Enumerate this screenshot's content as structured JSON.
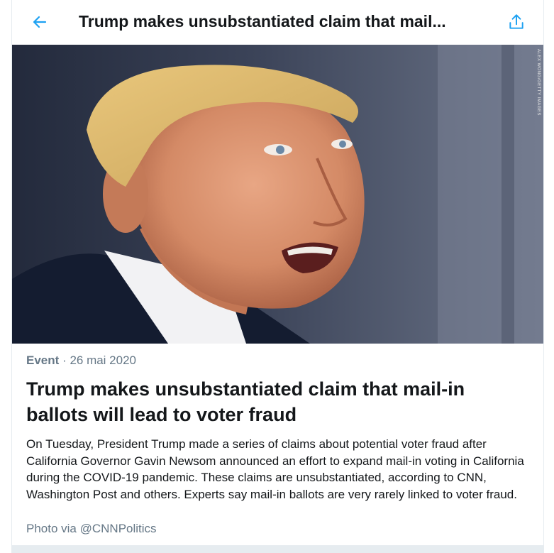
{
  "header": {
    "title": "Trump makes unsubstantiated claim that mail...",
    "back_icon": "arrow-left-icon",
    "share_icon": "share-icon",
    "accent_color": "#1da1f2"
  },
  "photo": {
    "credit": "ALEX WONG/GETTY IMAGES"
  },
  "event": {
    "category": "Event",
    "separator": "·",
    "date": "26 mai 2020",
    "headline": "Trump makes unsubstantiated claim that mail-in ballots will lead to voter fraud",
    "description": "On Tuesday, President Trump made a series of claims about potential voter fraud after California Governor Gavin Newsom announced an effort to expand mail-in voting in California during the COVID-19 pandemic. These claims are unsubstantiated, according to CNN, Washington Post and others. Experts say mail-in ballots are very rarely linked to voter fraud.",
    "photo_attribution": "Photo via @CNNPolitics"
  }
}
